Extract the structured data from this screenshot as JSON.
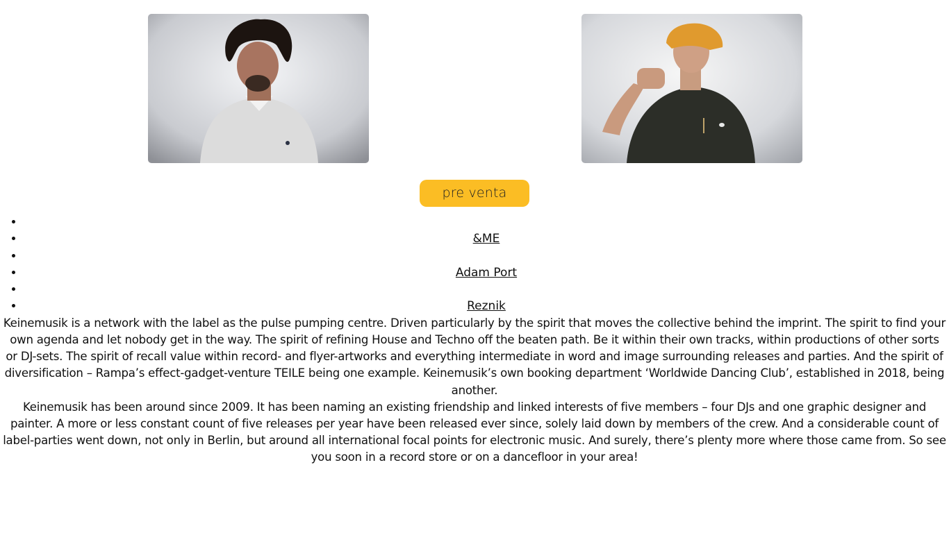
{
  "photos": {
    "left_alt": "artist portrait",
    "right_alt": "artist portrait"
  },
  "presale_button": {
    "label": "pre venta"
  },
  "artists": [
    {
      "name": ""
    },
    {
      "name": "&ME"
    },
    {
      "name": ""
    },
    {
      "name": "Adam Port"
    },
    {
      "name": ""
    },
    {
      "name": "Reznik"
    }
  ],
  "description": {
    "paragraph_1": "Keinemusik is a network with the label as the pulse pumping centre. Driven particularly by the spirit that moves the collective behind the imprint. The spirit to find your own agenda and let nobody get in the way. The spirit of refining House and Techno off the beaten path. Be it within their own tracks, within productions of other sorts or DJ-sets. The spirit of recall value within record- and flyer-artworks and everything intermediate in word and image surrounding releases and parties. And the spirit of diversification – Rampa’s effect-gadget-venture TEILE being one example. Keinemusik’s own booking department ‘Worldwide Dancing Club’, established in 2018, being another.",
    "paragraph_2": "Keinemusik has been around since 2009. It has been naming an existing friendship and linked interests of five members – four DJs and one graphic designer and painter. A more or less constant count of five releases per year have been released ever since, solely laid down by members of the crew. And a considerable count of label-parties went down, not only in Berlin, but around all international focal points for electronic music. And surely, there’s plenty more where those came from. So see you soon in a record store or on a dancefloor in your area!"
  },
  "colors": {
    "button_bg": "#fbbd24",
    "text": "#111111",
    "background": "#ffffff"
  }
}
